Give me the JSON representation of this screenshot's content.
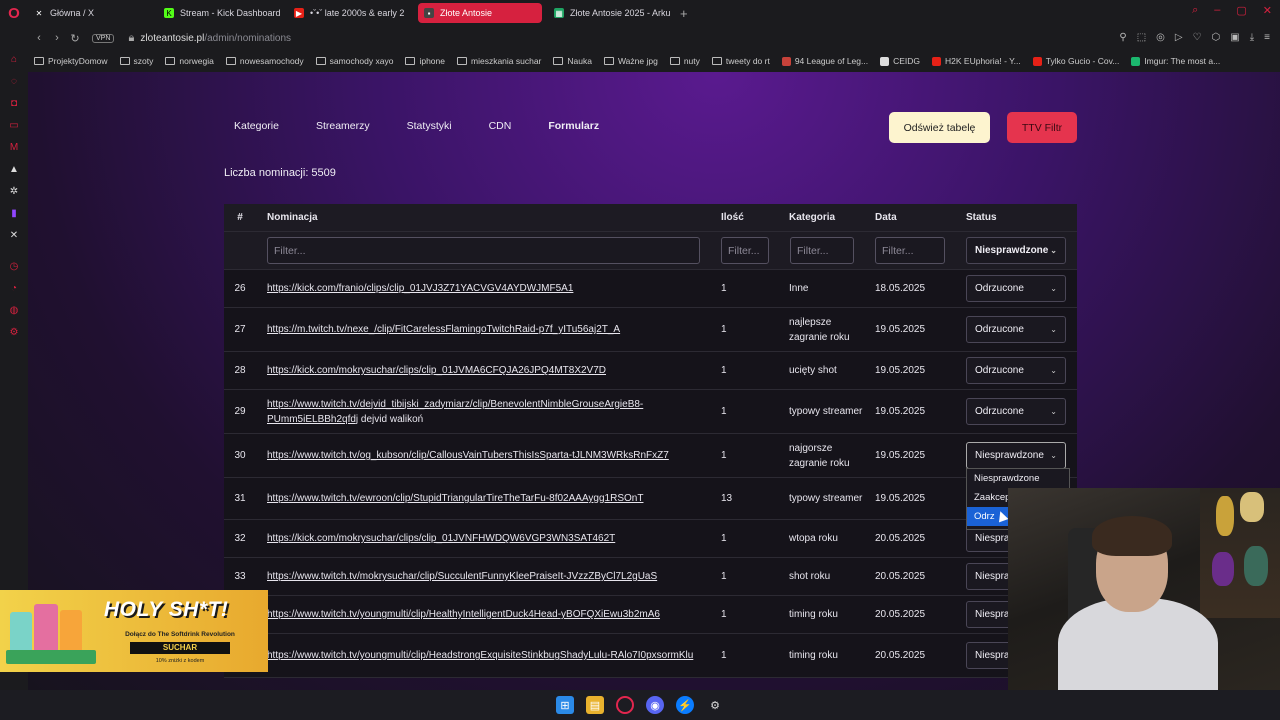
{
  "browser": {
    "tabs": [
      {
        "label": "Główna / X",
        "icon": "x-icon",
        "active": false
      },
      {
        "label": "Stream - Kick Dashboard",
        "icon": "kick-icon",
        "active": false
      },
      {
        "label": "•ˇ•ˇ late 2000s & early 2",
        "icon": "youtube-icon",
        "active": false
      },
      {
        "label": "Złote Antosie",
        "icon": "site-icon",
        "active": true
      },
      {
        "label": "Złote Antosie 2025 - Arku",
        "icon": "sheets-icon",
        "active": false
      }
    ],
    "new_tab": "+",
    "vpn_label": "VPN",
    "url_domain": "zloteantosie.pl",
    "url_path": "/admin/nominations",
    "bookmarks": [
      {
        "label": "ProjektyDomow",
        "type": "folder"
      },
      {
        "label": "szoty",
        "type": "folder"
      },
      {
        "label": "norwegia",
        "type": "folder"
      },
      {
        "label": "nowesamochody",
        "type": "folder"
      },
      {
        "label": "samochody xayo",
        "type": "folder"
      },
      {
        "label": "iphone",
        "type": "folder"
      },
      {
        "label": "mieszkania suchar",
        "type": "folder"
      },
      {
        "label": "Nauka",
        "type": "folder"
      },
      {
        "label": "Ważne jpg",
        "type": "folder"
      },
      {
        "label": "nuty",
        "type": "folder"
      },
      {
        "label": "tweety do rt",
        "type": "folder"
      },
      {
        "label": "94 League of Leg...",
        "type": "site"
      },
      {
        "label": "CEIDG",
        "type": "site"
      },
      {
        "label": "H2K EUphoria! - Y...",
        "type": "site"
      },
      {
        "label": "Tylko Gucio - Cov...",
        "type": "site"
      },
      {
        "label": "Imgur: The most a...",
        "type": "site"
      }
    ]
  },
  "nav": {
    "links": [
      "Kategorie",
      "Streamerzy",
      "Statystyki",
      "CDN",
      "Formularz"
    ],
    "refresh_button": "Odśwież tabelę",
    "ttv_button": "TTV Filtr"
  },
  "count": {
    "label": "Liczba nominacji:",
    "value": "5509"
  },
  "table": {
    "headers": {
      "num": "#",
      "nom": "Nominacja",
      "qty": "Ilość",
      "cat": "Kategoria",
      "date": "Data",
      "status": "Status"
    },
    "filters": {
      "nom": "Filter...",
      "qty": "Filter...",
      "cat": "Filter...",
      "date": "Filter...",
      "status": "Niesprawdzone"
    },
    "rows": [
      {
        "num": "26",
        "link": "https://kick.com/franio/clips/clip_01JVJ3Z71YACVGV4AYDWJMF5A1",
        "extra": "",
        "qty": "1",
        "cat": "Inne",
        "date": "18.05.2025",
        "status": "Odrzucone"
      },
      {
        "num": "27",
        "link": "https://m.twitch.tv/nexe_/clip/FitCarelessFlamingoTwitchRaid-p7f_yITu56aj2T_A",
        "extra": "",
        "qty": "1",
        "cat": "najlepsze zagranie roku",
        "date": "19.05.2025",
        "status": "Odrzucone"
      },
      {
        "num": "28",
        "link": "https://kick.com/mokrysuchar/clips/clip_01JVMA6CFQJA26JPQ4MT8X2V7D",
        "extra": "",
        "qty": "1",
        "cat": "ucięty shot",
        "date": "19.05.2025",
        "status": "Odrzucone"
      },
      {
        "num": "29",
        "link": "https://www.twitch.tv/dejvid_tibijski_zadymiarz/clip/BenevolentNimbleGrouseArgieB8-PUmm5iELBBh2qfdj",
        "extra": " dejvid walikoń",
        "qty": "1",
        "cat": "typowy streamer",
        "date": "19.05.2025",
        "status": "Odrzucone"
      },
      {
        "num": "30",
        "link": "https://www.twitch.tv/og_kubson/clip/CallousVainTubersThisIsSparta-tJLNM3WRksRnFxZ7",
        "extra": "",
        "qty": "1",
        "cat": "najgorsze zagranie roku",
        "date": "19.05.2025",
        "status": "Niesprawdzone"
      },
      {
        "num": "31",
        "link": "https://www.twitch.tv/ewroon/clip/StupidTriangularTireTheTarFu-8f02AAAygg1RSOnT",
        "extra": "",
        "qty": "13",
        "cat": "typowy streamer",
        "date": "19.05.2025",
        "status": ""
      },
      {
        "num": "32",
        "link": "https://kick.com/mokrysuchar/clips/clip_01JVNFHWDQW6VGP3WN3SAT462T",
        "extra": "",
        "qty": "1",
        "cat": "wtopa roku",
        "date": "20.05.2025",
        "status": "Niespra"
      },
      {
        "num": "33",
        "link": "https://www.twitch.tv/mokrysuchar/clip/SucculentFunnyKleePraiseIt-JVzzZByCl7L2gUaS",
        "extra": "",
        "qty": "1",
        "cat": "shot roku",
        "date": "20.05.2025",
        "status": "Niespra"
      },
      {
        "num": "34",
        "link": "https://www.twitch.tv/youngmulti/clip/HealthyIntelligentDuck4Head-yBOFQXiEwu3b2mA6",
        "extra": "",
        "qty": "1",
        "cat": "timing roku",
        "date": "20.05.2025",
        "status": "Niespra"
      },
      {
        "num": "35",
        "link": "https://www.twitch.tv/youngmulti/clip/HeadstrongExquisiteStinkbugShadyLulu-RAlo7I0pxsormKlu",
        "extra": "",
        "qty": "1",
        "cat": "timing roku",
        "date": "20.05.2025",
        "status": "Niespra"
      }
    ]
  },
  "dropdown": {
    "options": [
      "Niesprawdzone",
      "Zaakcep",
      "Odrz"
    ],
    "selected": "Odrz"
  },
  "promo": {
    "title": "HOLY SH*T!",
    "subtitle": "Dołącz do The Softdrink Revolution",
    "brand": "SUCHAR",
    "discount": "10% zniżki z kodem"
  },
  "colors": {
    "accent": "#d6213f",
    "refresh_bg": "#fdf4cf",
    "ttv_bg": "#e5344e",
    "select_highlight": "#1a62d6"
  }
}
